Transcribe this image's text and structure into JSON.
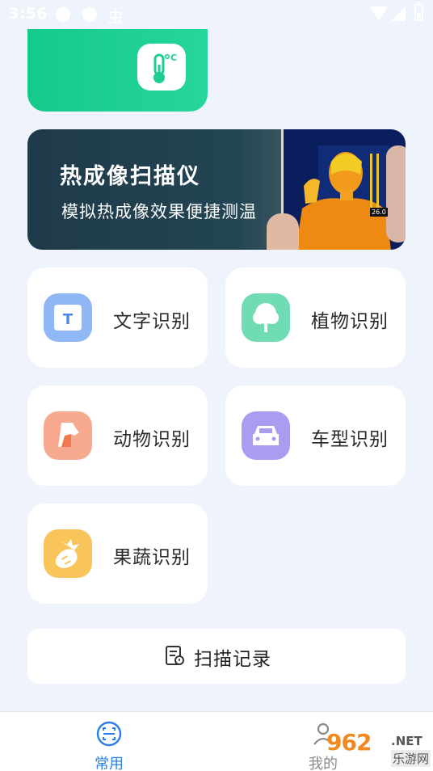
{
  "status_bar": {
    "time": "3:56",
    "bug_glyph": "虫"
  },
  "banner": {
    "title": "热成像扫描仪",
    "subtitle": "模拟热成像效果便捷测温",
    "temp_readout": "26.0"
  },
  "features": [
    {
      "label": "文字识别",
      "icon": "text-recognition-icon",
      "icon_color": "#8fb6f5"
    },
    {
      "label": "植物识别",
      "icon": "plant-recognition-icon",
      "icon_color": "#6fdcb4"
    },
    {
      "label": "动物识别",
      "icon": "animal-recognition-icon",
      "icon_color": "#f6a98e"
    },
    {
      "label": "车型识别",
      "icon": "car-recognition-icon",
      "icon_color": "#ab9cf2"
    },
    {
      "label": "果蔬识别",
      "icon": "fruit-veg-recognition-icon",
      "icon_color": "#f9c55a"
    }
  ],
  "scan_record": {
    "label": "扫描记录"
  },
  "bottom_nav": {
    "tabs": [
      {
        "label": "常用",
        "active": true
      },
      {
        "label": "我的",
        "active": false
      }
    ]
  },
  "watermark": {
    "brand": "962",
    "tld": ".NET",
    "site": "乐游网"
  },
  "colors": {
    "accent": "#2b7de9",
    "green": "#1ccf91"
  }
}
